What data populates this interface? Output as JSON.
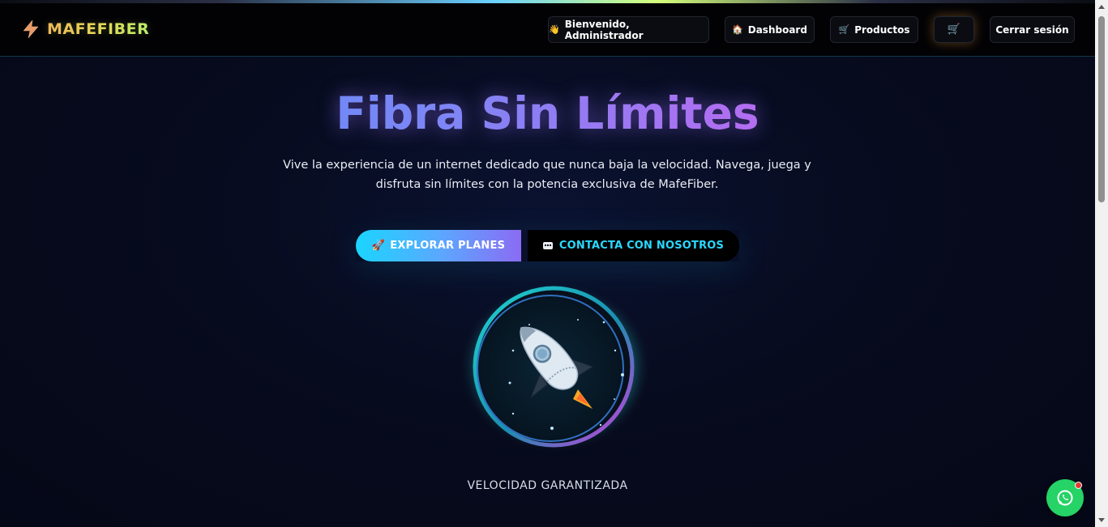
{
  "header": {
    "brand": "MAFEFIBER",
    "nav": {
      "welcome": "Bienvenido, Administrador",
      "dashboard": "Dashboard",
      "products": "Productos",
      "logout": "Cerrar sesión"
    },
    "icons": {
      "welcome": "waving-hand-icon",
      "dashboard": "home-icon",
      "products": "cart-icon",
      "cart": "shopping-cart-icon",
      "brand": "lightning-bolt-icon"
    }
  },
  "hero": {
    "title": "Fibra Sin Límites",
    "subtitle": "Vive la experiencia de un internet dedicado que nunca baja la velocidad. Navega, juega y disfruta sin límites con la potencia exclusiva de MafeFiber.",
    "cta_primary": "EXPLORAR PLANES",
    "cta_secondary": "CONTACTA CON NOSOTROS",
    "caption": "VELOCIDAD GARANTIZADA"
  },
  "colors": {
    "accent_cyan": "#1ad5ff",
    "accent_purple": "#b56cf0",
    "whatsapp": "#25d366"
  }
}
